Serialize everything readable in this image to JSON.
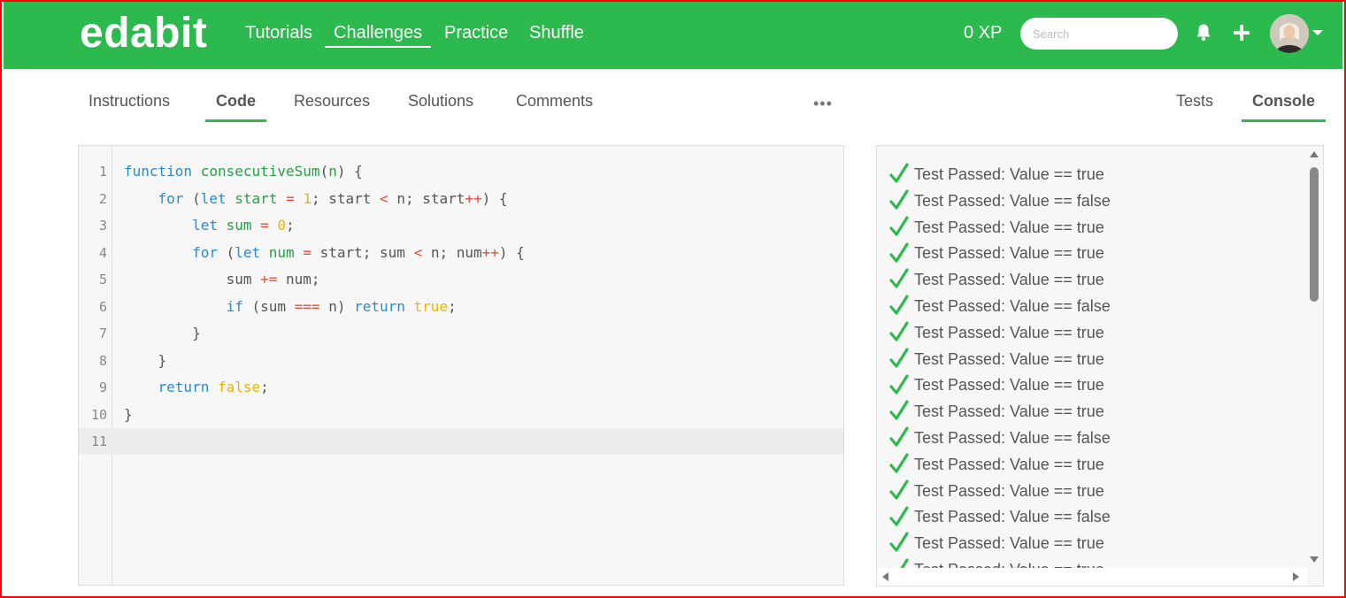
{
  "app": {
    "logo": "edabit"
  },
  "nav": {
    "tutorials": "Tutorials",
    "challenges": "Challenges",
    "practice": "Practice",
    "shuffle": "Shuffle"
  },
  "header": {
    "xp": "0 XP",
    "search_placeholder": "Search"
  },
  "tabs": {
    "instructions": "Instructions",
    "code": "Code",
    "resources": "Resources",
    "solutions": "Solutions",
    "comments": "Comments",
    "more": "•••",
    "tests": "Tests",
    "console": "Console"
  },
  "editor": {
    "line_numbers": [
      "1",
      "2",
      "3",
      "4",
      "5",
      "6",
      "7",
      "8",
      "9",
      "10",
      "11"
    ],
    "lines": [
      "function consecutiveSum(n) {",
      "    for (let start = 1; start < n; start++) {",
      "        let sum = 0;",
      "        for (let num = start; sum < n; num++) {",
      "            sum += num;",
      "            if (sum === n) return true;",
      "        }",
      "    }",
      "    return false;",
      "}",
      ""
    ],
    "active_line": 11
  },
  "console": {
    "prefix": "Test Passed: ",
    "results": [
      "Value == true",
      "Value == false",
      "Value == true",
      "Value == true",
      "Value == true",
      "Value == false",
      "Value == true",
      "Value == true",
      "Value == true",
      "Value == true",
      "Value == false",
      "Value == true",
      "Value == true",
      "Value == false",
      "Value == true",
      "Value == true"
    ]
  },
  "colors": {
    "brand": "#2cb94e",
    "keyword": "#2a8ad4",
    "function": "#27a048",
    "literal": "#f0b400",
    "operator": "#e74c3c",
    "check": "#2cb94e",
    "frame": "#ff0000"
  },
  "icons": {
    "bell": "bell-icon",
    "plus": "plus-icon",
    "caret": "chevron-down-icon",
    "check": "check-icon"
  }
}
